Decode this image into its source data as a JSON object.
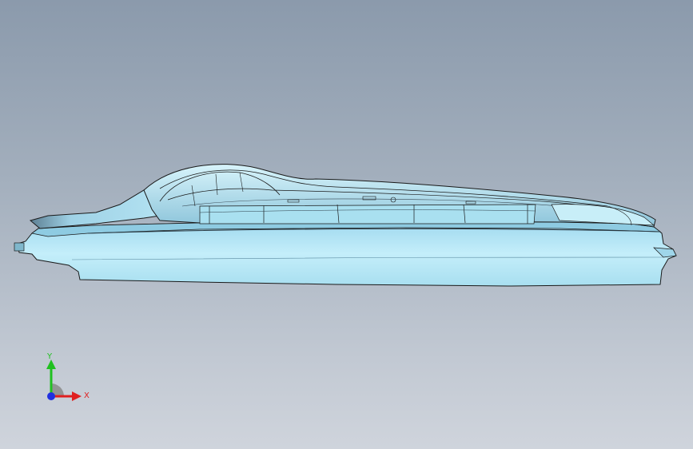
{
  "viewport": {
    "background_top": "#8b9aac",
    "background_bottom": "#cfd4dc",
    "model_color": "#b7e6f5",
    "edge_color": "#1a1a1a"
  },
  "triad": {
    "x_label": "X",
    "y_label": "Y",
    "x_color": "#e02020",
    "y_color": "#20c020",
    "z_color": "#2030e0"
  }
}
